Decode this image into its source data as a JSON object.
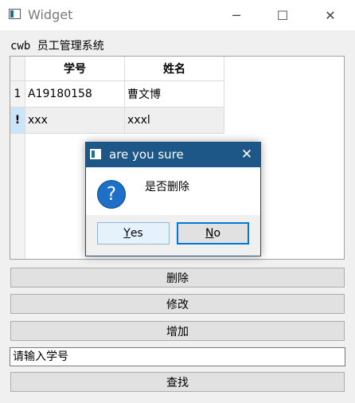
{
  "window": {
    "title": "Widget",
    "minimize_glyph": "─",
    "maximize_glyph": "☐",
    "close_glyph": "✕"
  },
  "heading": "cwb 员工管理系统",
  "table": {
    "columns": [
      "学号",
      "姓名"
    ],
    "rows": [
      {
        "header": "1",
        "id": "A19180158",
        "name": "曹文博"
      },
      {
        "header": "!",
        "id": "xxx",
        "name": "xxxl"
      }
    ]
  },
  "buttons": {
    "delete": "删除",
    "modify": "修改",
    "add": "增加",
    "search": "查找"
  },
  "search": {
    "value": "请输入学号"
  },
  "dialog": {
    "title": "are you sure",
    "message": "是否删除",
    "icon": "question-icon",
    "yes_mnemonic": "Y",
    "yes_rest": "es",
    "no_mnemonic": "N",
    "no_rest": "o",
    "close_glyph": "✕"
  },
  "colors": {
    "dialog_titlebar": "#1d5788",
    "focus": "#0078d7",
    "row_selected": "#cce4f7"
  }
}
